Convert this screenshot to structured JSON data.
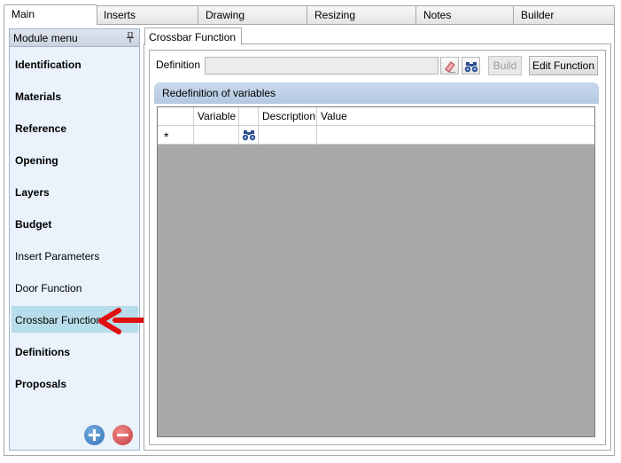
{
  "top_tabs": [
    "Main",
    "Inserts",
    "Drawing",
    "Resizing",
    "Notes",
    "Builder"
  ],
  "module_menu": {
    "title": "Module menu",
    "items": [
      {
        "label": "Identification",
        "bold": true
      },
      {
        "label": "Materials",
        "bold": true
      },
      {
        "label": "Reference",
        "bold": true
      },
      {
        "label": "Opening",
        "bold": true
      },
      {
        "label": "Layers",
        "bold": true
      },
      {
        "label": "Budget",
        "bold": true
      },
      {
        "label": "Insert Parameters",
        "bold": false
      },
      {
        "label": "Door Function",
        "bold": false
      },
      {
        "label": "Crossbar Function",
        "bold": false,
        "selected": true
      },
      {
        "label": "Definitions",
        "bold": true
      },
      {
        "label": "Proposals",
        "bold": true
      }
    ]
  },
  "sub_tab": "Crossbar Function",
  "definition": {
    "label": "Definition",
    "value": "",
    "build_label": "Build",
    "edit_label": "Edit Function"
  },
  "section_title": "Redefinition of variables",
  "grid": {
    "columns": [
      "",
      "Variable",
      "",
      "Description",
      "Value"
    ],
    "new_row_marker": "*"
  },
  "colors": {
    "selected_item": "#b6dde9",
    "arrow": "#e01010",
    "grid_empty": "#a9a9a9"
  },
  "icons": [
    "pin-icon",
    "eraser-icon",
    "binoculars-icon",
    "add-icon",
    "remove-icon",
    "arrow-annotation"
  ]
}
